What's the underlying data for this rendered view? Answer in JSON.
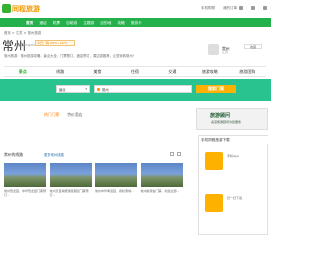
{
  "site": {
    "logo_text": "同程旅游",
    "top_links": [
      "手机购物",
      "我的订单"
    ],
    "top_icons": [
      "user-icon",
      "phone-icon",
      "heart-icon"
    ]
  },
  "nav": {
    "items": [
      "首页",
      "酒店",
      "机票",
      "自助游",
      "主题游",
      "目的地",
      "攻略",
      "旅游卡"
    ]
  },
  "breadcrumb": "首页 > 江苏 > 常州旅游",
  "city": {
    "title": "常州",
    "pinyin": "Changzhou",
    "weather": "今日：晴 24°C~16°C",
    "intro": "常州旅游：常州旅游攻略、景点大全、门票预订、酒店预订、周边游推荐，让您玩转常州！"
  },
  "card": {
    "name": "常州",
    "sub": "江苏",
    "btn": "收藏"
  },
  "tabs": [
    "景点",
    "线路",
    "美食",
    "住宿",
    "交通",
    "旅游攻略",
    "旅游团购"
  ],
  "search": {
    "type": "景点",
    "value": "常州",
    "button": "搜索门票"
  },
  "hot_tabs": [
    "热门门票",
    "特价酒店"
  ],
  "section": {
    "title": "常州的线路",
    "sub": "更多常州线路"
  },
  "gallery": [
    {
      "caption": "常州恐龙园、中华恐龙园门票预订..."
    },
    {
      "caption": "常州天目湖旅游度假区门票预订..."
    },
    {
      "caption": "常州中华孝道园、春秋淹城..."
    },
    {
      "caption": "常州嬉戏谷门票、动漫主题..."
    }
  ],
  "banner": {
    "title": "旅游顾问",
    "sub": "资深旅游顾问为您服务"
  },
  "right_box": {
    "title": "手机同程旅游下载",
    "items": [
      {
        "title": "手机App"
      },
      {
        "title": "扫一扫下载"
      }
    ]
  }
}
